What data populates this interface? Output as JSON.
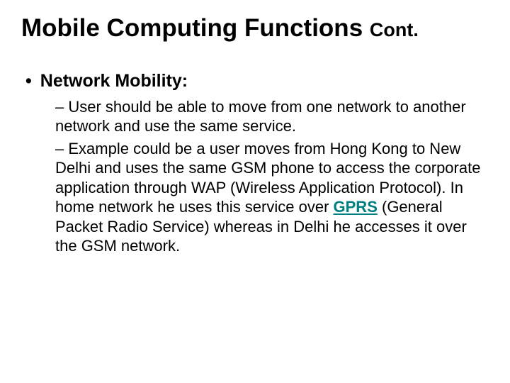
{
  "title": {
    "main": "Mobile Computing Functions ",
    "cont": "Cont."
  },
  "bullet": {
    "marker": "•",
    "label": "Network Mobility:"
  },
  "sub": {
    "dash": "–",
    "item1": "User should be able to move from one network to another network and use the same service.",
    "item2_pre": "Example could be a user moves from Hong Kong to New Delhi and uses the same GSM phone to access the corporate application through WAP (Wireless Application Protocol). In home network he uses this service over ",
    "item2_link": "GPRS",
    "item2_post": " (General Packet Radio Service) whereas in Delhi he accesses it over the GSM network."
  }
}
